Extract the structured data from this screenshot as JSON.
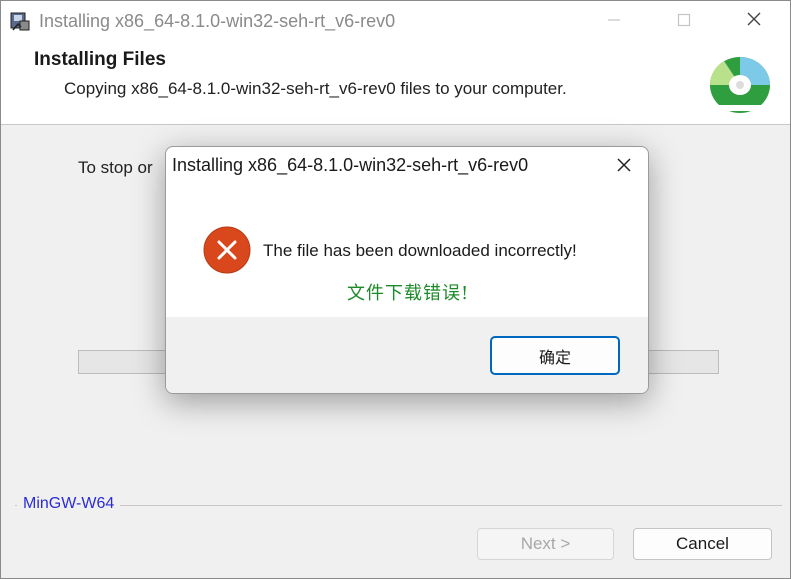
{
  "window": {
    "title": "Installing x86_64-8.1.0-win32-seh-rt_v6-rev0",
    "minimize_icon": "minimize-icon",
    "maximize_icon": "maximize-icon",
    "close_icon": "close-icon"
  },
  "header": {
    "title": "Installing Files",
    "subtitle": "Copying x86_64-8.1.0-win32-seh-rt_v6-rev0 files to your computer."
  },
  "body": {
    "stop_text": "To stop or",
    "progress": 0
  },
  "footer": {
    "brand": "MinGW-W64",
    "next_label": "Next >",
    "cancel_label": "Cancel"
  },
  "dialog": {
    "title": "Installing x86_64-8.1.0-win32-seh-rt_v6-rev0",
    "icon": "error-icon",
    "message": "The file has been downloaded incorrectly!",
    "message_cn": "文件下载错误!",
    "ok_label": "确定"
  },
  "colors": {
    "error_icon": "#d9481c",
    "cn_message": "#1d8a2a",
    "brand_text": "#2b2bd8",
    "ok_border": "#0067c0"
  }
}
